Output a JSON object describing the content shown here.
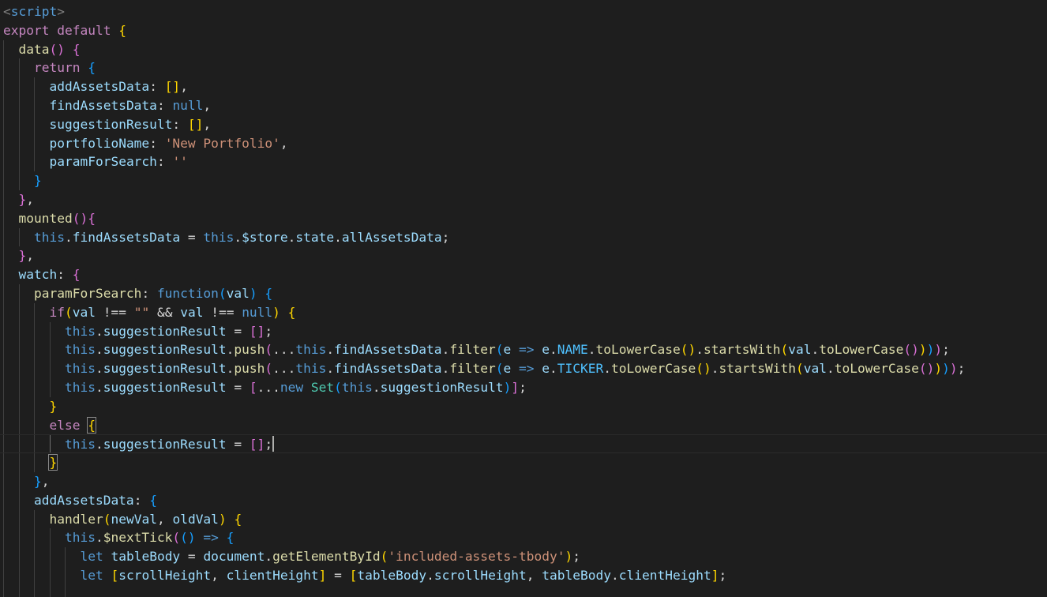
{
  "editor": {
    "language": "vue-javascript",
    "colors": {
      "background": "#1e1e1e",
      "text": "#d4d4d4",
      "keyword_control": "#c586c0",
      "keyword_storage": "#569cd6",
      "variable": "#9cdcfe",
      "function": "#dcdcaa",
      "string": "#ce9178",
      "class": "#4ec9b0",
      "constant": "#4fc1ff",
      "tag_punctuation": "#808080",
      "bracket_level1": "#ffd700",
      "bracket_level2": "#da70d6",
      "bracket_level3": "#179fff"
    },
    "lines": [
      {
        "indent": 0,
        "tokens": [
          {
            "t": "<",
            "c": "#808080"
          },
          {
            "t": "script",
            "c": "#569cd6"
          },
          {
            "t": ">",
            "c": "#808080"
          }
        ]
      },
      {
        "indent": 0,
        "tokens": [
          {
            "t": "export",
            "c": "#c586c0"
          },
          {
            "t": " "
          },
          {
            "t": "default",
            "c": "#c586c0"
          },
          {
            "t": " "
          },
          {
            "t": "{",
            "c": "#ffd700"
          }
        ]
      },
      {
        "indent": 1,
        "tokens": [
          {
            "t": "data",
            "c": "#dcdcaa"
          },
          {
            "t": "()",
            "c": "#da70d6"
          },
          {
            "t": " "
          },
          {
            "t": "{",
            "c": "#da70d6"
          }
        ]
      },
      {
        "indent": 2,
        "tokens": [
          {
            "t": "return",
            "c": "#c586c0"
          },
          {
            "t": " "
          },
          {
            "t": "{",
            "c": "#179fff"
          }
        ]
      },
      {
        "indent": 3,
        "tokens": [
          {
            "t": "addAssetsData",
            "c": "#9cdcfe"
          },
          {
            "t": ": "
          },
          {
            "t": "[]",
            "c": "#ffd700"
          },
          {
            "t": ","
          }
        ]
      },
      {
        "indent": 3,
        "tokens": [
          {
            "t": "findAssetsData",
            "c": "#9cdcfe"
          },
          {
            "t": ": "
          },
          {
            "t": "null",
            "c": "#569cd6"
          },
          {
            "t": ","
          }
        ]
      },
      {
        "indent": 3,
        "tokens": [
          {
            "t": "suggestionResult",
            "c": "#9cdcfe"
          },
          {
            "t": ": "
          },
          {
            "t": "[]",
            "c": "#ffd700"
          },
          {
            "t": ","
          }
        ]
      },
      {
        "indent": 3,
        "tokens": [
          {
            "t": "portfolioName",
            "c": "#9cdcfe"
          },
          {
            "t": ": "
          },
          {
            "t": "'New Portfolio'",
            "c": "#ce9178"
          },
          {
            "t": ","
          }
        ]
      },
      {
        "indent": 3,
        "tokens": [
          {
            "t": "paramForSearch",
            "c": "#9cdcfe"
          },
          {
            "t": ": "
          },
          {
            "t": "''",
            "c": "#ce9178"
          }
        ]
      },
      {
        "indent": 2,
        "tokens": [
          {
            "t": "}",
            "c": "#179fff"
          }
        ]
      },
      {
        "indent": 1,
        "tokens": [
          {
            "t": "}",
            "c": "#da70d6"
          },
          {
            "t": ","
          }
        ]
      },
      {
        "indent": 1,
        "tokens": [
          {
            "t": "mounted",
            "c": "#dcdcaa"
          },
          {
            "t": "()",
            "c": "#da70d6"
          },
          {
            "t": "{",
            "c": "#da70d6"
          }
        ]
      },
      {
        "indent": 2,
        "tokens": [
          {
            "t": "this",
            "c": "#569cd6"
          },
          {
            "t": "."
          },
          {
            "t": "findAssetsData",
            "c": "#9cdcfe"
          },
          {
            "t": " = "
          },
          {
            "t": "this",
            "c": "#569cd6"
          },
          {
            "t": "."
          },
          {
            "t": "$store",
            "c": "#9cdcfe"
          },
          {
            "t": "."
          },
          {
            "t": "state",
            "c": "#9cdcfe"
          },
          {
            "t": "."
          },
          {
            "t": "allAssetsData",
            "c": "#9cdcfe"
          },
          {
            "t": ";"
          }
        ]
      },
      {
        "indent": 1,
        "tokens": [
          {
            "t": "}",
            "c": "#da70d6"
          },
          {
            "t": ","
          }
        ]
      },
      {
        "indent": 1,
        "tokens": [
          {
            "t": "watch",
            "c": "#9cdcfe"
          },
          {
            "t": ": "
          },
          {
            "t": "{",
            "c": "#da70d6"
          }
        ]
      },
      {
        "indent": 2,
        "tokens": [
          {
            "t": "paramForSearch",
            "c": "#dcdcaa"
          },
          {
            "t": ": "
          },
          {
            "t": "function",
            "c": "#569cd6"
          },
          {
            "t": "(",
            "c": "#179fff"
          },
          {
            "t": "val",
            "c": "#9cdcfe"
          },
          {
            "t": ")",
            "c": "#179fff"
          },
          {
            "t": " "
          },
          {
            "t": "{",
            "c": "#179fff"
          }
        ]
      },
      {
        "indent": 3,
        "tokens": [
          {
            "t": "if",
            "c": "#c586c0"
          },
          {
            "t": "(",
            "c": "#ffd700"
          },
          {
            "t": "val",
            "c": "#9cdcfe"
          },
          {
            "t": " !== "
          },
          {
            "t": "\"\"",
            "c": "#ce9178"
          },
          {
            "t": " && "
          },
          {
            "t": "val",
            "c": "#9cdcfe"
          },
          {
            "t": " !== "
          },
          {
            "t": "null",
            "c": "#569cd6"
          },
          {
            "t": ")",
            "c": "#ffd700"
          },
          {
            "t": " "
          },
          {
            "t": "{",
            "c": "#ffd700"
          }
        ]
      },
      {
        "indent": 4,
        "tokens": [
          {
            "t": "this",
            "c": "#569cd6"
          },
          {
            "t": "."
          },
          {
            "t": "suggestionResult",
            "c": "#9cdcfe"
          },
          {
            "t": " = "
          },
          {
            "t": "[]",
            "c": "#da70d6"
          },
          {
            "t": ";"
          }
        ]
      },
      {
        "indent": 4,
        "tokens": [
          {
            "t": "this",
            "c": "#569cd6"
          },
          {
            "t": "."
          },
          {
            "t": "suggestionResult",
            "c": "#9cdcfe"
          },
          {
            "t": "."
          },
          {
            "t": "push",
            "c": "#dcdcaa"
          },
          {
            "t": "(",
            "c": "#da70d6"
          },
          {
            "t": "..."
          },
          {
            "t": "this",
            "c": "#569cd6"
          },
          {
            "t": "."
          },
          {
            "t": "findAssetsData",
            "c": "#9cdcfe"
          },
          {
            "t": "."
          },
          {
            "t": "filter",
            "c": "#dcdcaa"
          },
          {
            "t": "(",
            "c": "#179fff"
          },
          {
            "t": "e",
            "c": "#9cdcfe"
          },
          {
            "t": " "
          },
          {
            "t": "=>",
            "c": "#569cd6"
          },
          {
            "t": " "
          },
          {
            "t": "e",
            "c": "#9cdcfe"
          },
          {
            "t": "."
          },
          {
            "t": "NAME",
            "c": "#4fc1ff"
          },
          {
            "t": "."
          },
          {
            "t": "toLowerCase",
            "c": "#dcdcaa"
          },
          {
            "t": "()",
            "c": "#ffd700"
          },
          {
            "t": "."
          },
          {
            "t": "startsWith",
            "c": "#dcdcaa"
          },
          {
            "t": "(",
            "c": "#ffd700"
          },
          {
            "t": "val",
            "c": "#9cdcfe"
          },
          {
            "t": "."
          },
          {
            "t": "toLowerCase",
            "c": "#dcdcaa"
          },
          {
            "t": "()",
            "c": "#da70d6"
          },
          {
            "t": ")",
            "c": "#ffd700"
          },
          {
            "t": ")",
            "c": "#179fff"
          },
          {
            "t": ")",
            "c": "#da70d6"
          },
          {
            "t": ";"
          }
        ]
      },
      {
        "indent": 4,
        "tokens": [
          {
            "t": "this",
            "c": "#569cd6"
          },
          {
            "t": "."
          },
          {
            "t": "suggestionResult",
            "c": "#9cdcfe"
          },
          {
            "t": "."
          },
          {
            "t": "push",
            "c": "#dcdcaa"
          },
          {
            "t": "(",
            "c": "#da70d6"
          },
          {
            "t": "..."
          },
          {
            "t": "this",
            "c": "#569cd6"
          },
          {
            "t": "."
          },
          {
            "t": "findAssetsData",
            "c": "#9cdcfe"
          },
          {
            "t": "."
          },
          {
            "t": "filter",
            "c": "#dcdcaa"
          },
          {
            "t": "(",
            "c": "#179fff"
          },
          {
            "t": "e",
            "c": "#9cdcfe"
          },
          {
            "t": " "
          },
          {
            "t": "=>",
            "c": "#569cd6"
          },
          {
            "t": " "
          },
          {
            "t": "e",
            "c": "#9cdcfe"
          },
          {
            "t": "."
          },
          {
            "t": "TICKER",
            "c": "#4fc1ff"
          },
          {
            "t": "."
          },
          {
            "t": "toLowerCase",
            "c": "#dcdcaa"
          },
          {
            "t": "()",
            "c": "#ffd700"
          },
          {
            "t": "."
          },
          {
            "t": "startsWith",
            "c": "#dcdcaa"
          },
          {
            "t": "(",
            "c": "#ffd700"
          },
          {
            "t": "val",
            "c": "#9cdcfe"
          },
          {
            "t": "."
          },
          {
            "t": "toLowerCase",
            "c": "#dcdcaa"
          },
          {
            "t": "()",
            "c": "#da70d6"
          },
          {
            "t": ")",
            "c": "#ffd700"
          },
          {
            "t": ")",
            "c": "#179fff"
          },
          {
            "t": ")",
            "c": "#da70d6"
          },
          {
            "t": ";"
          }
        ]
      },
      {
        "indent": 4,
        "tokens": [
          {
            "t": "this",
            "c": "#569cd6"
          },
          {
            "t": "."
          },
          {
            "t": "suggestionResult",
            "c": "#9cdcfe"
          },
          {
            "t": " = "
          },
          {
            "t": "[",
            "c": "#da70d6"
          },
          {
            "t": "..."
          },
          {
            "t": "new",
            "c": "#569cd6"
          },
          {
            "t": " "
          },
          {
            "t": "Set",
            "c": "#4ec9b0"
          },
          {
            "t": "(",
            "c": "#179fff"
          },
          {
            "t": "this",
            "c": "#569cd6"
          },
          {
            "t": "."
          },
          {
            "t": "suggestionResult",
            "c": "#9cdcfe"
          },
          {
            "t": ")",
            "c": "#179fff"
          },
          {
            "t": "]",
            "c": "#da70d6"
          },
          {
            "t": ";"
          }
        ]
      },
      {
        "indent": 3,
        "tokens": [
          {
            "t": "}",
            "c": "#ffd700"
          }
        ]
      },
      {
        "indent": 3,
        "tokens": [
          {
            "t": "else",
            "c": "#c586c0"
          },
          {
            "t": " "
          },
          {
            "t": "{",
            "c": "#ffd700",
            "box": true
          }
        ]
      },
      {
        "indent": 4,
        "current": true,
        "caret": true,
        "tokens": [
          {
            "t": "this",
            "c": "#569cd6"
          },
          {
            "t": "."
          },
          {
            "t": "suggestionResult",
            "c": "#9cdcfe"
          },
          {
            "t": " = "
          },
          {
            "t": "[]",
            "c": "#da70d6"
          },
          {
            "t": ";"
          }
        ]
      },
      {
        "indent": 3,
        "tokens": [
          {
            "t": "}",
            "c": "#ffd700",
            "box": true
          }
        ]
      },
      {
        "indent": 2,
        "tokens": [
          {
            "t": "}",
            "c": "#179fff"
          },
          {
            "t": ","
          }
        ]
      },
      {
        "indent": 2,
        "tokens": [
          {
            "t": "addAssetsData",
            "c": "#9cdcfe"
          },
          {
            "t": ": "
          },
          {
            "t": "{",
            "c": "#179fff"
          }
        ]
      },
      {
        "indent": 3,
        "tokens": [
          {
            "t": "handler",
            "c": "#dcdcaa"
          },
          {
            "t": "(",
            "c": "#ffd700"
          },
          {
            "t": "newVal",
            "c": "#9cdcfe"
          },
          {
            "t": ", "
          },
          {
            "t": "oldVal",
            "c": "#9cdcfe"
          },
          {
            "t": ")",
            "c": "#ffd700"
          },
          {
            "t": " "
          },
          {
            "t": "{",
            "c": "#ffd700"
          }
        ]
      },
      {
        "indent": 4,
        "tokens": [
          {
            "t": "this",
            "c": "#569cd6"
          },
          {
            "t": "."
          },
          {
            "t": "$nextTick",
            "c": "#dcdcaa"
          },
          {
            "t": "(",
            "c": "#da70d6"
          },
          {
            "t": "()",
            "c": "#179fff"
          },
          {
            "t": " "
          },
          {
            "t": "=>",
            "c": "#569cd6"
          },
          {
            "t": " "
          },
          {
            "t": "{",
            "c": "#179fff"
          }
        ]
      },
      {
        "indent": 5,
        "tokens": [
          {
            "t": "let",
            "c": "#569cd6"
          },
          {
            "t": " "
          },
          {
            "t": "tableBody",
            "c": "#9cdcfe"
          },
          {
            "t": " = "
          },
          {
            "t": "document",
            "c": "#9cdcfe"
          },
          {
            "t": "."
          },
          {
            "t": "getElementById",
            "c": "#dcdcaa"
          },
          {
            "t": "(",
            "c": "#ffd700"
          },
          {
            "t": "'included-assets-tbody'",
            "c": "#ce9178"
          },
          {
            "t": ")",
            "c": "#ffd700"
          },
          {
            "t": ";"
          }
        ]
      },
      {
        "indent": 5,
        "tokens": [
          {
            "t": "let",
            "c": "#569cd6"
          },
          {
            "t": " "
          },
          {
            "t": "[",
            "c": "#ffd700"
          },
          {
            "t": "scrollHeight",
            "c": "#9cdcfe"
          },
          {
            "t": ", "
          },
          {
            "t": "clientHeight",
            "c": "#9cdcfe"
          },
          {
            "t": "]",
            "c": "#ffd700"
          },
          {
            "t": " = "
          },
          {
            "t": "[",
            "c": "#ffd700"
          },
          {
            "t": "tableBody",
            "c": "#9cdcfe"
          },
          {
            "t": "."
          },
          {
            "t": "scrollHeight",
            "c": "#9cdcfe"
          },
          {
            "t": ", "
          },
          {
            "t": "tableBody",
            "c": "#9cdcfe"
          },
          {
            "t": "."
          },
          {
            "t": "clientHeight",
            "c": "#9cdcfe"
          },
          {
            "t": "]",
            "c": "#ffd700"
          },
          {
            "t": ";"
          }
        ]
      },
      {
        "indent": 5,
        "tokens": []
      }
    ]
  }
}
